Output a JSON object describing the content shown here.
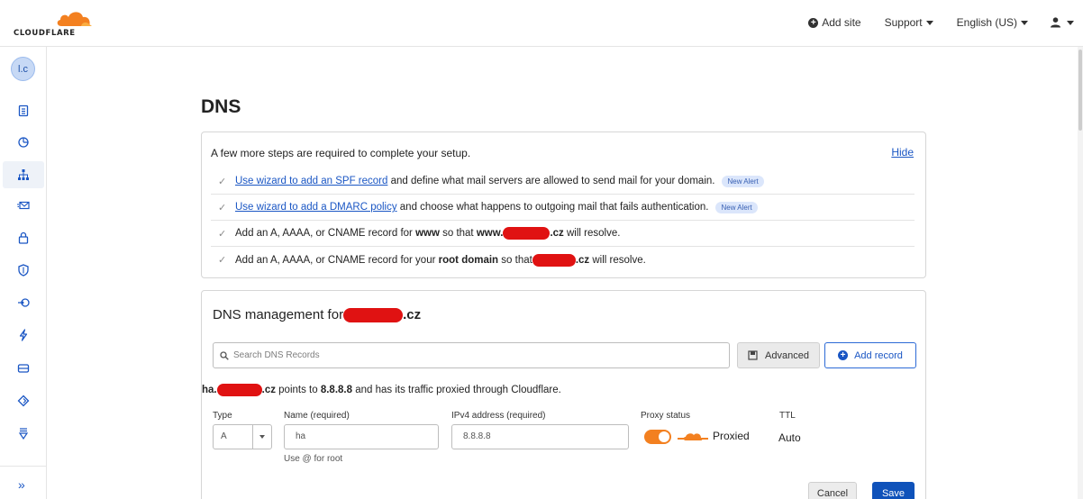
{
  "header": {
    "logo_text": "CLOUDFLARE",
    "add_site": "Add site",
    "support": "Support",
    "language": "English (US)"
  },
  "sidebar": {
    "avatar": "l.c",
    "items": [
      {
        "icon": "overview-icon"
      },
      {
        "icon": "analytics-icon"
      },
      {
        "icon": "dns-icon",
        "active": true
      },
      {
        "icon": "email-icon"
      },
      {
        "icon": "ssl-lock-icon"
      },
      {
        "icon": "security-shield-icon"
      },
      {
        "icon": "access-icon"
      },
      {
        "icon": "speed-bolt-icon"
      },
      {
        "icon": "caching-icon"
      },
      {
        "icon": "workers-icon"
      },
      {
        "icon": "rules-icon"
      }
    ],
    "expand": "»"
  },
  "page": {
    "title": "DNS"
  },
  "setup": {
    "title": "A few more steps are required to complete your setup.",
    "hide": "Hide",
    "step1_link": "Use wizard to add an SPF record",
    "step1_text": " and define what mail servers are allowed to send mail for your domain.",
    "step2_link": "Use wizard to add a DMARC policy",
    "step2_text": " and choose what happens to outgoing mail that fails authentication.",
    "badge": "New Alert",
    "step3_pre": "Add an A, AAAA, or CNAME record for ",
    "step3_bold": "www",
    "step3_mid": " so that ",
    "step3_bold2": "www.",
    "step3_suffix": ".cz",
    "step3_end": " will resolve.",
    "step4_pre": "Add an A, AAAA, or CNAME record for your ",
    "step4_bold": "root domain",
    "step4_mid": " so that",
    "step4_suffix": ".cz",
    "step4_end": " will resolve."
  },
  "dns": {
    "title_pre": "DNS management for",
    "title_suffix": ".cz",
    "search_placeholder": "Search DNS Records",
    "advanced": "Advanced",
    "add_record": "Add record",
    "points_pre": "ha.",
    "points_suffix": ".cz",
    "points_mid": " points to ",
    "points_ip": "8.8.8.8",
    "points_end": " and has its traffic proxied through Cloudflare.",
    "form": {
      "type_label": "Type",
      "type_value": "A",
      "name_label": "Name (required)",
      "name_value": "ha",
      "name_hint": "Use @ for root",
      "ipv4_label": "IPv4 address (required)",
      "ipv4_value": "8.8.8.8",
      "proxy_label": "Proxy status",
      "proxy_value": "Proxied",
      "proxy_on": true,
      "ttl_label": "TTL",
      "ttl_value": "Auto"
    },
    "cancel": "Cancel",
    "save": "Save"
  },
  "colors": {
    "accent_blue": "#1a56c4",
    "save_blue": "#0f52ba",
    "cloudflare_orange": "#f38020",
    "badge_bg": "#dbe6fb",
    "redaction": "#e01212"
  }
}
